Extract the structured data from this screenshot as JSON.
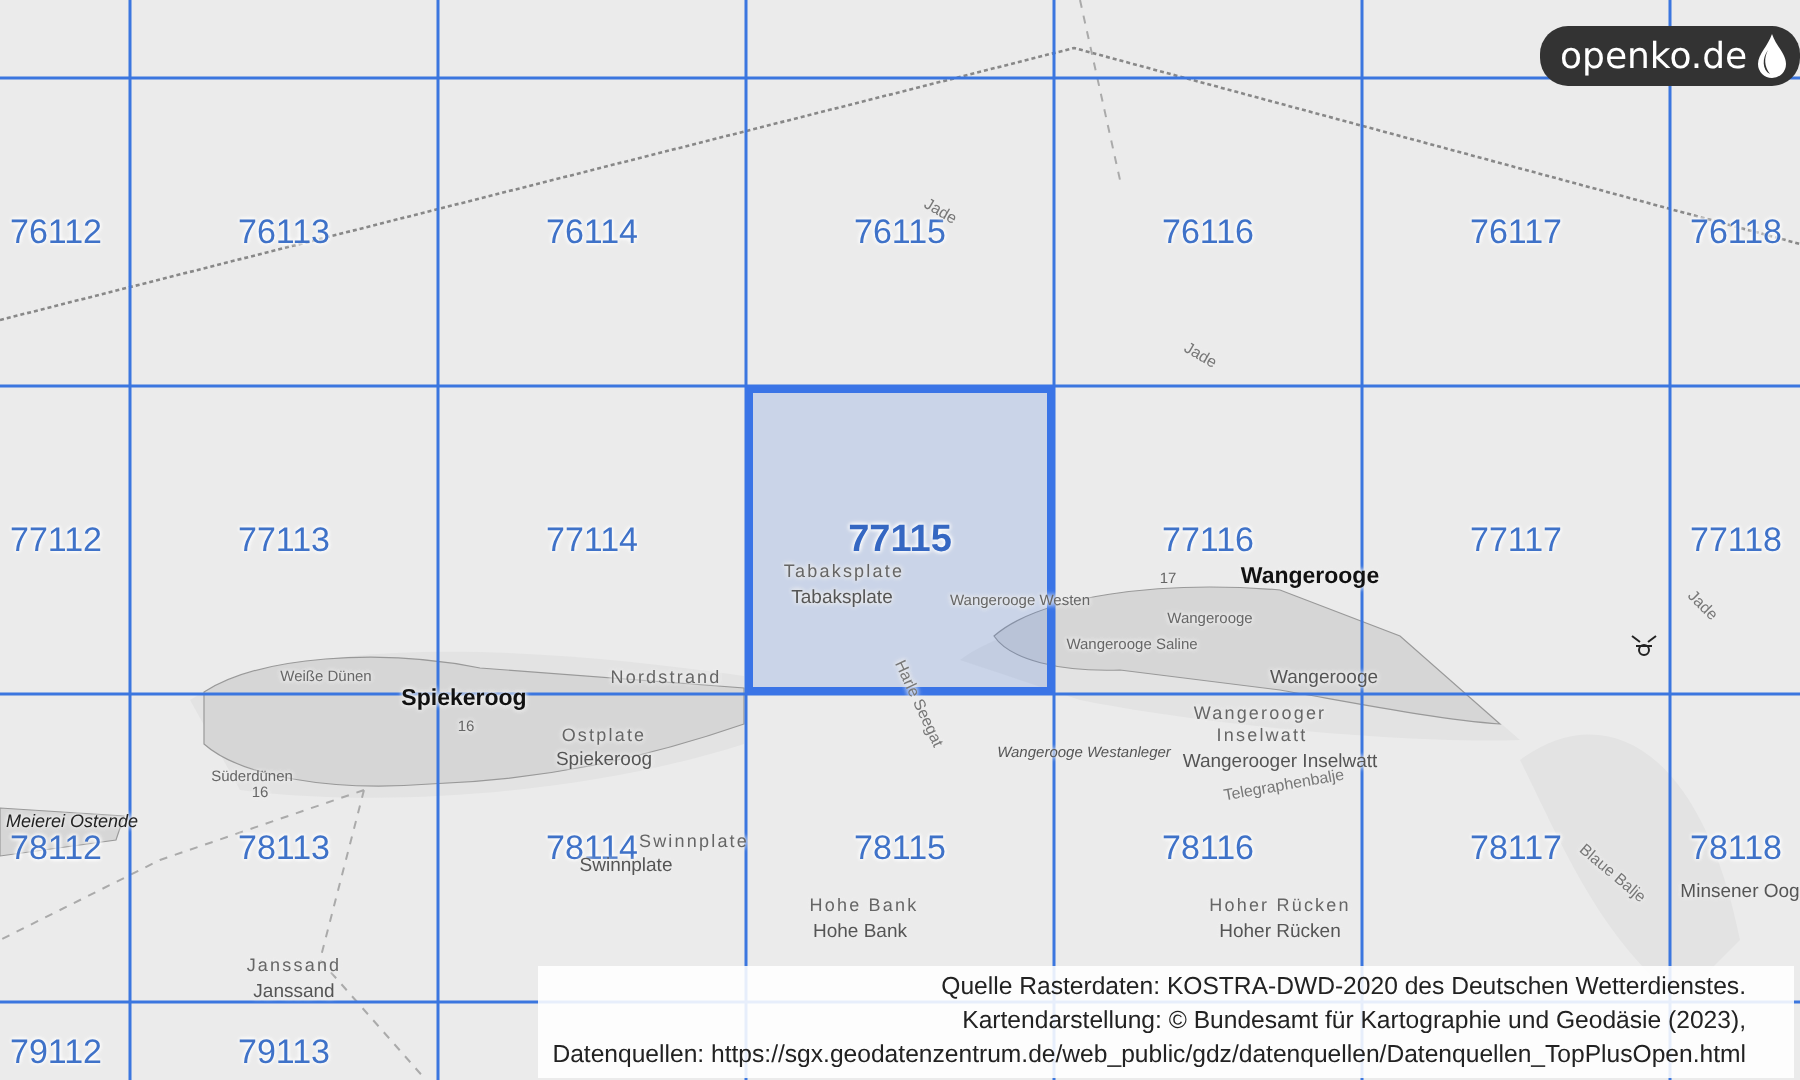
{
  "map": {
    "grid": [
      {
        "cells": [
          {
            "label": "76112",
            "selected": false
          },
          {
            "label": "76113",
            "selected": false
          },
          {
            "label": "76114",
            "selected": false
          },
          {
            "label": "76115",
            "selected": false
          },
          {
            "label": "76116",
            "selected": false
          },
          {
            "label": "76117",
            "selected": false
          },
          {
            "label": "76118",
            "selected": false
          }
        ]
      },
      {
        "cells": [
          {
            "label": "77112",
            "selected": false
          },
          {
            "label": "77113",
            "selected": false
          },
          {
            "label": "77114",
            "selected": false
          },
          {
            "label": "77115",
            "selected": true
          },
          {
            "label": "77116",
            "selected": false
          },
          {
            "label": "77117",
            "selected": false
          },
          {
            "label": "77118",
            "selected": false
          }
        ]
      },
      {
        "cells": [
          {
            "label": "78112",
            "selected": false
          },
          {
            "label": "78113",
            "selected": false
          },
          {
            "label": "78114",
            "selected": false
          },
          {
            "label": "78115",
            "selected": false
          },
          {
            "label": "78116",
            "selected": false
          },
          {
            "label": "78117",
            "selected": false
          },
          {
            "label": "78118",
            "selected": false
          }
        ]
      },
      {
        "cells": [
          {
            "label": "79112",
            "selected": false
          },
          {
            "label": "79113",
            "selected": false
          }
        ]
      }
    ],
    "places": [
      {
        "name": "Jade",
        "kind": "water"
      },
      {
        "name": "Jade",
        "kind": "water"
      },
      {
        "name": "Tabaksplate",
        "kind": "spaced"
      },
      {
        "name": "17",
        "kind": "small"
      },
      {
        "name": "Wangerooge",
        "kind": "island"
      },
      {
        "name": "Tabaksplate",
        "kind": "plain"
      },
      {
        "name": "Wangerooge Westen",
        "kind": "small"
      },
      {
        "name": "Wangerooge",
        "kind": "small"
      },
      {
        "name": "Jade",
        "kind": "water"
      },
      {
        "name": "Wangerooge Saline",
        "kind": "small"
      },
      {
        "name": "Weiße Dünen",
        "kind": "small"
      },
      {
        "name": "Nordstrand",
        "kind": "spaced"
      },
      {
        "name": "Wangerooge",
        "kind": "plain"
      },
      {
        "name": "Spiekeroog",
        "kind": "island"
      },
      {
        "name": "Harle Seegat",
        "kind": "water"
      },
      {
        "name": "Wangerooger",
        "kind": "spaced"
      },
      {
        "name": "16",
        "kind": "small"
      },
      {
        "name": "Ostplate",
        "kind": "spaced"
      },
      {
        "name": "Inselwatt",
        "kind": "spaced"
      },
      {
        "name": "Spiekeroog",
        "kind": "plain"
      },
      {
        "name": "Wangerooge Westanleger",
        "kind": "italic-small"
      },
      {
        "name": "Wangerooger Inselwatt",
        "kind": "plain"
      },
      {
        "name": "Süderdünen",
        "kind": "small"
      },
      {
        "name": "16",
        "kind": "small"
      },
      {
        "name": "Telegraphenbalje",
        "kind": "water"
      },
      {
        "name": "Meierei Ostende",
        "kind": "italic"
      },
      {
        "name": "Swinnplate",
        "kind": "spaced"
      },
      {
        "name": "Swinnplate",
        "kind": "plain"
      },
      {
        "name": "Blaue Balje",
        "kind": "water"
      },
      {
        "name": "Minsener Oog",
        "kind": "plain"
      },
      {
        "name": "Hohe Bank",
        "kind": "spaced"
      },
      {
        "name": "Hoher Rücken",
        "kind": "spaced"
      },
      {
        "name": "Hohe Bank",
        "kind": "plain"
      },
      {
        "name": "Hoher Rücken",
        "kind": "plain"
      },
      {
        "name": "Janssand",
        "kind": "spaced"
      },
      {
        "name": "Janssand",
        "kind": "plain"
      }
    ]
  },
  "logo": {
    "text": "openko.de"
  },
  "attribution": {
    "lines": [
      "Quelle Rasterdaten: KOSTRA-DWD-2020 des Deutschen Wetterdienstes.",
      "Kartendarstellung: © Bundesamt für Kartographie und Geodäsie (2023),",
      "Datenquellen: https://sgx.geodatenzentrum.de/web_public/gdz/datenquellen/Datenquellen_TopPlusOpen.html"
    ]
  }
}
